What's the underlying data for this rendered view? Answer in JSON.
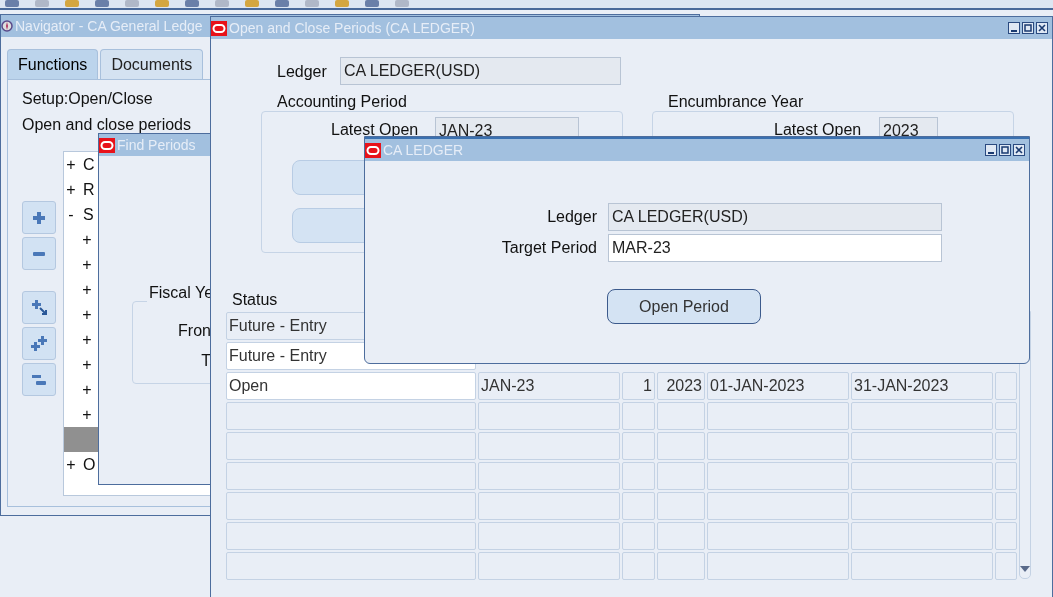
{
  "navigator": {
    "title": "Navigator - CA General Ledge",
    "tabs": [
      {
        "label": "Functions",
        "selected": true
      },
      {
        "label": "Documents",
        "selected": false
      }
    ],
    "heading": "Setup:Open/Close",
    "description": "Open and close periods",
    "tree": [
      {
        "toggle": "+",
        "label": "C",
        "selected": false
      },
      {
        "toggle": "+",
        "label": "R",
        "selected": false
      },
      {
        "toggle": "-",
        "label": "S",
        "selected": false,
        "children": [
          {
            "toggle": "+",
            "selected": false
          },
          {
            "toggle": "+",
            "selected": false
          },
          {
            "toggle": "+",
            "selected": false
          },
          {
            "toggle": "+",
            "selected": false
          },
          {
            "toggle": "+",
            "selected": false
          },
          {
            "toggle": "+",
            "selected": false
          },
          {
            "toggle": "+",
            "selected": false
          },
          {
            "toggle": "+",
            "selected": false
          },
          {
            "selected": true
          }
        ]
      },
      {
        "toggle": "+",
        "label": "O",
        "selected": false
      }
    ]
  },
  "find_periods": {
    "title": "Find Periods",
    "group_label": "Fiscal Ye",
    "fields": [
      {
        "label": "Fron"
      },
      {
        "label": "T"
      }
    ]
  },
  "periods": {
    "title": "Open and Close Periods (CA LEDGER)",
    "ledger": {
      "label": "Ledger",
      "value": "CA LEDGER(USD)"
    },
    "accounting_period": {
      "title": "Accounting Period",
      "latest_open": {
        "label": "Latest Open",
        "value": "JAN-23"
      }
    },
    "encumbrance_year": {
      "title": "Encumbrance Year",
      "latest_open": {
        "label": "Latest Open",
        "value": "2023"
      }
    },
    "table": {
      "columns": [
        "Status"
      ],
      "rows": [
        {
          "cells": [
            "Future - Entry"
          ],
          "editable": false
        },
        {
          "cells": [
            "Future - Entry"
          ],
          "editable": true
        },
        {
          "cells": [
            "Open",
            "JAN-23",
            "1",
            "2023",
            "01-JAN-2023",
            "31-JAN-2023"
          ],
          "editable": true
        }
      ]
    }
  },
  "dialog": {
    "title": "CA LEDGER",
    "ledger": {
      "label": "Ledger",
      "value": "CA LEDGER(USD)"
    },
    "target_period": {
      "label": "Target Period",
      "value": "MAR-23"
    },
    "button": "Open Period"
  }
}
